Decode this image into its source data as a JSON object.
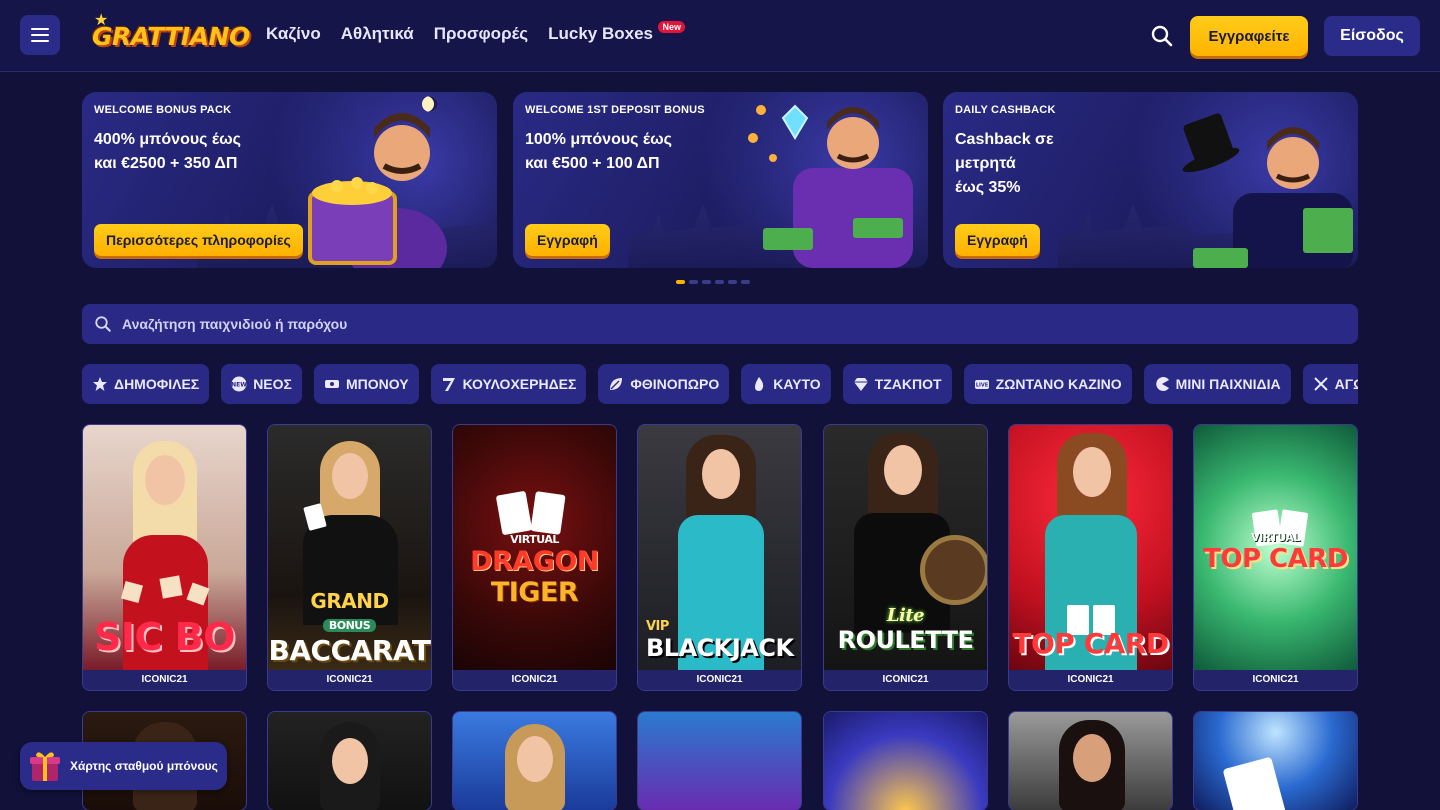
{
  "header": {
    "logo_text": "GRATTIANO",
    "nav": [
      {
        "label": "Καζίνο"
      },
      {
        "label": "Αθλητικά"
      },
      {
        "label": "Προσφορές"
      },
      {
        "label": "Lucky Boxes",
        "badge": "New"
      }
    ],
    "register_label": "Εγγραφείτε",
    "login_label": "Είσοδος"
  },
  "banners": [
    {
      "tag": "WELCOME BONUS PACK",
      "title": "400% μπόνους έως\nκαι €2500 + 350 ΔΠ",
      "cta": "Περισσότερες πληροφορίες"
    },
    {
      "tag": "WELCOME 1ST DEPOSIT BONUS",
      "title": "100% μπόνους έως\nκαι €500 + 100 ΔΠ",
      "cta": "Εγγραφή"
    },
    {
      "tag": "DAILY CASHBACK",
      "title": "Cashback σε\nμετρητά\nέως 35%",
      "cta": "Εγγραφή"
    }
  ],
  "carousel": {
    "slide_count": 6,
    "active_index": 0
  },
  "search": {
    "placeholder": "Αναζήτηση παιχνιδιού ή παρόχου"
  },
  "categories": [
    {
      "label": "ΔΗΜΟΦΙΛΕΣ",
      "icon": "star-icon"
    },
    {
      "label": "ΝΕΟΣ",
      "icon": "new-icon"
    },
    {
      "label": "ΜΠΟΝΟΥ",
      "icon": "bonus-icon"
    },
    {
      "label": "ΚΟΥΛΟΧΕΡΗΔΕΣ",
      "icon": "slot-seven-icon"
    },
    {
      "label": "ΦΘΙΝΟΠΩΡΟ",
      "icon": "leaf-icon"
    },
    {
      "label": "ΚΑΥΤΟ",
      "icon": "flame-icon"
    },
    {
      "label": "ΤΖΑΚΠΟΤ",
      "icon": "diamond-icon"
    },
    {
      "label": "ΖΩΝΤΑΝΟ ΚΑΖΙΝΟ",
      "icon": "live-icon"
    },
    {
      "label": "ΜΙΝΙ ΠΑΙΧΝΙΔΙΑ",
      "icon": "pacman-icon"
    },
    {
      "label": "ΑΓΩΝ",
      "icon": "crossed-swords-icon"
    }
  ],
  "games_row1": [
    {
      "title": "SIC BO",
      "provider": "ICONIC21"
    },
    {
      "title": "GRAND BONUS BACCARAT",
      "provider": "ICONIC21"
    },
    {
      "title": "VIRTUAL DRAGON TIGER",
      "provider": "ICONIC21"
    },
    {
      "title": "VIP BLACKJACK",
      "provider": "ICONIC21"
    },
    {
      "title": "Lite ROULETTE",
      "provider": "ICONIC21"
    },
    {
      "title": "TOP CARD",
      "provider": "ICONIC21"
    },
    {
      "title": "VIRTUAL TOP CARD",
      "provider": "ICONIC21"
    }
  ],
  "bonus_map": {
    "label": "Χάρτης σταθμού μπόνους"
  },
  "colors": {
    "background": "#11113a",
    "accent": "#ffb300",
    "panel": "#2a2a86"
  }
}
